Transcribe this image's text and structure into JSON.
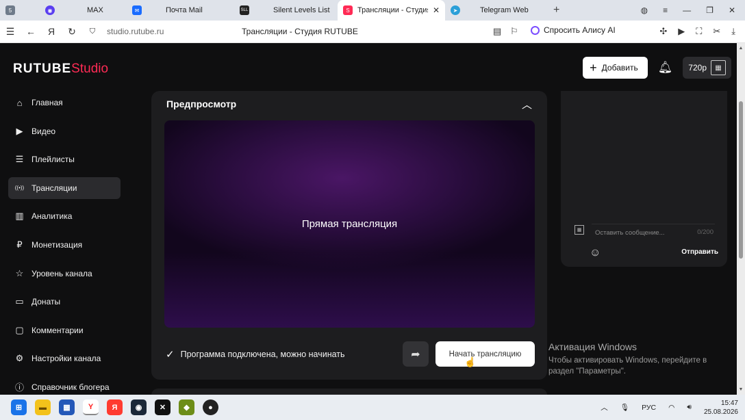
{
  "browser": {
    "tabs": [
      {
        "label": "",
        "icon": "5",
        "color": "#6f7b8a"
      },
      {
        "label": "MAX",
        "icon": "max-icon",
        "color": "#5a3ef0"
      },
      {
        "label": "Почта Mail",
        "icon": "mail-icon",
        "color": "#1a6cff"
      },
      {
        "label": "Silent Levels List",
        "icon": "SLL",
        "color": "#222"
      },
      {
        "label": "Трансляции - Студия",
        "icon": "rutube-icon",
        "color": "#ff2b55",
        "active": true
      },
      {
        "label": "Telegram Web",
        "icon": "telegram-icon",
        "color": "#2a9fd8"
      }
    ],
    "url": "studio.rutube.ru",
    "page_title": "Трансляции - Студия RUTUBE",
    "alice": "Спросить Алису AI"
  },
  "app": {
    "logo_main": "RUTUBE",
    "logo_sub": "Studio",
    "add_label": "Добавить",
    "balance": "720р",
    "sidebar": [
      {
        "label": "Главная",
        "icon": "home-icon",
        "glyph": "⌂"
      },
      {
        "label": "Видео",
        "icon": "video-icon",
        "glyph": "▶"
      },
      {
        "label": "Плейлисты",
        "icon": "playlist-icon",
        "glyph": "☰"
      },
      {
        "label": "Трансляции",
        "icon": "broadcast-icon",
        "glyph": "((•))",
        "active": true
      },
      {
        "label": "Аналитика",
        "icon": "analytics-icon",
        "glyph": "▥"
      },
      {
        "label": "Монетизация",
        "icon": "monetization-icon",
        "glyph": "₽"
      },
      {
        "label": "Уровень канала",
        "icon": "star-icon",
        "glyph": "☆"
      },
      {
        "label": "Донаты",
        "icon": "donate-icon",
        "glyph": "▭"
      },
      {
        "label": "Комментарии",
        "icon": "comments-icon",
        "glyph": "▢"
      },
      {
        "label": "Настройки канала",
        "icon": "settings-icon",
        "glyph": "⚙"
      },
      {
        "label": "Справочник блогера",
        "icon": "info-icon",
        "glyph": "ⓘ"
      }
    ],
    "preview": {
      "title": "Предпросмотр",
      "placeholder": "Прямая трансляция",
      "status": "Программа подключена, можно начинать",
      "start_label": "Начать трансляцию"
    },
    "chat": {
      "placeholder": "Оставить сообщение...",
      "counter": "0/200",
      "send_label": "Отправить"
    }
  },
  "windows": {
    "activation_title": "Активация Windows",
    "activation_text_1": "Чтобы активировать Windows, перейдите в",
    "activation_text_2": "раздел \"Параметры\".",
    "lang": "РУС",
    "time": "15:47",
    "date": "25.08.2026"
  }
}
